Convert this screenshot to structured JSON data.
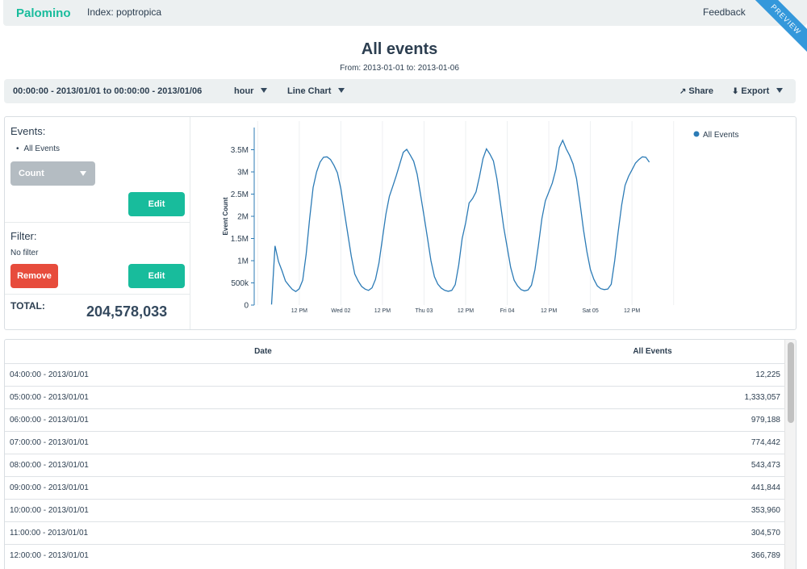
{
  "nav": {
    "brand": "Palomino",
    "index_label": "Index: poptropica",
    "feedback": "Feedback",
    "ribbon": "PREVIEW"
  },
  "header": {
    "title": "All events",
    "subtitle": "From: 2013-01-01 to: 2013-01-06"
  },
  "toolbar": {
    "range": "00:00:00 - 2013/01/01 to 00:00:00 - 2013/01/06",
    "interval": "hour",
    "chart_type": "Line Chart",
    "share": "Share",
    "export": "Export",
    "icons": [
      "share-icon",
      "download-icon"
    ]
  },
  "sidebar": {
    "events_label": "Events:",
    "event_item": "All Events",
    "aggregate": "Count",
    "edit_label": "Edit",
    "filter_label": "Filter:",
    "filter_value": "No filter",
    "remove_label": "Remove",
    "total_label": "TOTAL:",
    "total_value": "204,578,033"
  },
  "colors": {
    "brand": "#18bc9c",
    "danger": "#e74c3c",
    "line": "#2c7bb6",
    "nav_bg": "#ecf0f1",
    "ribbon": "#3498db"
  },
  "chart_data": {
    "type": "line",
    "x_unit": "hours since 2013-01-01 00:00",
    "ylabel": "Event Count",
    "ylim": [
      0,
      4000000
    ],
    "yticks": [
      0,
      500000,
      1000000,
      1500000,
      2000000,
      2500000,
      3000000,
      3500000
    ],
    "ytick_labels": [
      "0",
      "500k",
      "1M",
      "1.5M",
      "2M",
      "2.5M",
      "3M",
      "3.5M"
    ],
    "xticks": [
      {
        "x": 36,
        "label": "12 PM"
      },
      {
        "x": 48,
        "label": "Wed 02"
      },
      {
        "x": 60,
        "label": "12 PM"
      },
      {
        "x": 72,
        "label": "Thu 03"
      },
      {
        "x": 84,
        "label": "12 PM"
      },
      {
        "x": 96,
        "label": "Fri 04"
      },
      {
        "x": 108,
        "label": "12 PM"
      },
      {
        "x": 120,
        "label": "Sat 05"
      },
      {
        "x": 132,
        "label": "12 PM"
      }
    ],
    "xlim": [
      23,
      145
    ],
    "legend": "top-right",
    "grid": "vertical",
    "series": [
      {
        "name": "All Events",
        "points": [
          [
            28,
            12225
          ],
          [
            29,
            1333057
          ],
          [
            30,
            979188
          ],
          [
            31,
            774442
          ],
          [
            32,
            543473
          ],
          [
            33,
            441844
          ],
          [
            34,
            353960
          ],
          [
            35,
            304570
          ],
          [
            36,
            366789
          ],
          [
            37,
            560000
          ],
          [
            38,
            1150000
          ],
          [
            39,
            1950000
          ],
          [
            40,
            2650000
          ],
          [
            41,
            3000000
          ],
          [
            42,
            3220000
          ],
          [
            43,
            3330000
          ],
          [
            44,
            3340000
          ],
          [
            45,
            3280000
          ],
          [
            46,
            3150000
          ],
          [
            47,
            2980000
          ],
          [
            48,
            2620000
          ],
          [
            49,
            2100000
          ],
          [
            50,
            1600000
          ],
          [
            51,
            1100000
          ],
          [
            52,
            700000
          ],
          [
            53,
            540000
          ],
          [
            54,
            420000
          ],
          [
            55,
            360000
          ],
          [
            56,
            330000
          ],
          [
            57,
            390000
          ],
          [
            58,
            580000
          ],
          [
            59,
            950000
          ],
          [
            60,
            1500000
          ],
          [
            61,
            2050000
          ],
          [
            62,
            2450000
          ],
          [
            63,
            2680000
          ],
          [
            64,
            2920000
          ],
          [
            65,
            3180000
          ],
          [
            66,
            3440000
          ],
          [
            67,
            3510000
          ],
          [
            68,
            3380000
          ],
          [
            69,
            3240000
          ],
          [
            70,
            2950000
          ],
          [
            71,
            2480000
          ],
          [
            72,
            2000000
          ],
          [
            73,
            1500000
          ],
          [
            74,
            1000000
          ],
          [
            75,
            640000
          ],
          [
            76,
            470000
          ],
          [
            77,
            380000
          ],
          [
            78,
            330000
          ],
          [
            79,
            310000
          ],
          [
            80,
            330000
          ],
          [
            81,
            460000
          ],
          [
            82,
            900000
          ],
          [
            83,
            1500000
          ],
          [
            84,
            1850000
          ],
          [
            85,
            2300000
          ],
          [
            86,
            2400000
          ],
          [
            87,
            2550000
          ],
          [
            88,
            2900000
          ],
          [
            89,
            3300000
          ],
          [
            90,
            3520000
          ],
          [
            91,
            3400000
          ],
          [
            92,
            3250000
          ],
          [
            93,
            2850000
          ],
          [
            94,
            2300000
          ],
          [
            95,
            1750000
          ],
          [
            96,
            1300000
          ],
          [
            97,
            850000
          ],
          [
            98,
            560000
          ],
          [
            99,
            430000
          ],
          [
            100,
            350000
          ],
          [
            101,
            320000
          ],
          [
            102,
            340000
          ],
          [
            103,
            450000
          ],
          [
            104,
            800000
          ],
          [
            105,
            1350000
          ],
          [
            106,
            1950000
          ],
          [
            107,
            2350000
          ],
          [
            108,
            2550000
          ],
          [
            109,
            2750000
          ],
          [
            110,
            3050000
          ],
          [
            111,
            3550000
          ],
          [
            112,
            3710000
          ],
          [
            113,
            3520000
          ],
          [
            114,
            3370000
          ],
          [
            115,
            3180000
          ],
          [
            116,
            2850000
          ],
          [
            117,
            2300000
          ],
          [
            118,
            1700000
          ],
          [
            119,
            1200000
          ],
          [
            120,
            800000
          ],
          [
            121,
            580000
          ],
          [
            122,
            430000
          ],
          [
            123,
            370000
          ],
          [
            124,
            350000
          ],
          [
            125,
            360000
          ],
          [
            126,
            470000
          ],
          [
            127,
            1000000
          ],
          [
            128,
            1650000
          ],
          [
            129,
            2250000
          ],
          [
            130,
            2700000
          ],
          [
            131,
            2900000
          ],
          [
            132,
            3050000
          ],
          [
            133,
            3200000
          ],
          [
            134,
            3280000
          ],
          [
            135,
            3340000
          ],
          [
            136,
            3330000
          ],
          [
            137,
            3220000
          ]
        ]
      }
    ]
  },
  "table": {
    "headers": [
      "Date",
      "All Events"
    ],
    "rows": [
      [
        "04:00:00 - 2013/01/01",
        "12,225"
      ],
      [
        "05:00:00 - 2013/01/01",
        "1,333,057"
      ],
      [
        "06:00:00 - 2013/01/01",
        "979,188"
      ],
      [
        "07:00:00 - 2013/01/01",
        "774,442"
      ],
      [
        "08:00:00 - 2013/01/01",
        "543,473"
      ],
      [
        "09:00:00 - 2013/01/01",
        "441,844"
      ],
      [
        "10:00:00 - 2013/01/01",
        "353,960"
      ],
      [
        "11:00:00 - 2013/01/01",
        "304,570"
      ],
      [
        "12:00:00 - 2013/01/01",
        "366,789"
      ]
    ]
  }
}
